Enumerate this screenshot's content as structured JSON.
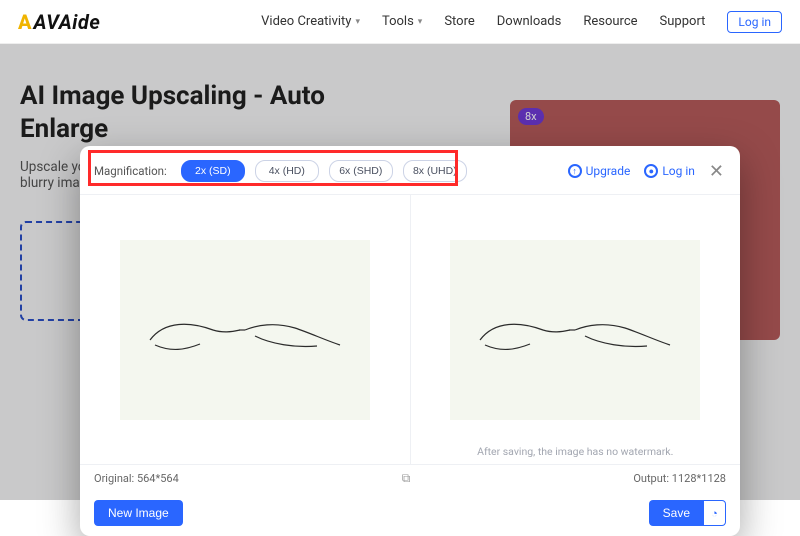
{
  "brand": "AVAide",
  "nav": {
    "video_creativity": "Video Creativity",
    "tools": "Tools",
    "store": "Store",
    "downloads": "Downloads",
    "resource": "Resource",
    "support": "Support",
    "login": "Log in"
  },
  "page": {
    "title": "AI Image Upscaling - Auto Enlarge",
    "desc": "Upscale your photos, remove noise and sharpen blurry images using AI.",
    "promo_tag": "8x"
  },
  "modal": {
    "magnification_label": "Magnification:",
    "options": {
      "x2": "2x (SD)",
      "x4": "4x (HD)",
      "x6": "6x (SHD)",
      "x8": "8x (UHD)"
    },
    "upgrade": "Upgrade",
    "login": "Log in",
    "watermark_note": "After saving, the image has no watermark.",
    "original_label": "Original: 564*564",
    "output_label": "Output: 1128*1128",
    "new_image": "New Image",
    "save": "Save"
  }
}
